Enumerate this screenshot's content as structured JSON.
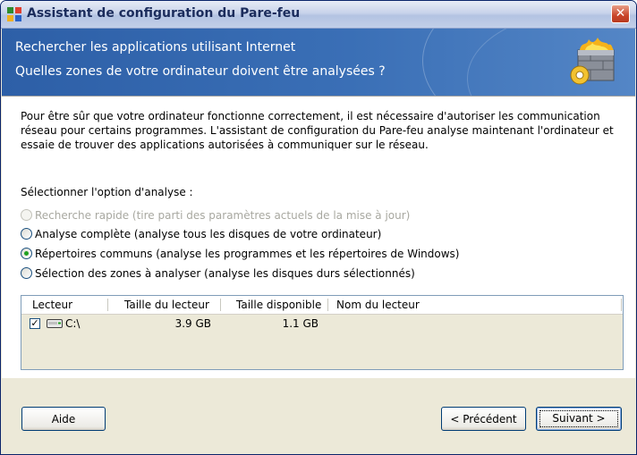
{
  "window": {
    "title": "Assistant de configuration du Pare-feu",
    "close_icon": "close-icon"
  },
  "header": {
    "title": "Rechercher les applications utilisant Internet",
    "subtitle": "Quelles zones de votre ordinateur doivent être analysées ?",
    "logo_icon": "firewall-icon"
  },
  "content": {
    "description": "Pour être sûr que votre ordinateur fonctionne correctement, il est nécessaire d'autoriser les communication réseau pour certains programmes. L'assistant de configuration du Pare-feu analyse maintenant l'ordinateur et essaie de trouver des applications autorisées à communiquer sur le réseau.",
    "scan_option_label": "Sélectionner l'option d'analyse :",
    "options": [
      {
        "label": "Recherche rapide (tire parti des paramètres actuels de la mise à jour)",
        "selected": false,
        "disabled": true
      },
      {
        "label": "Analyse complète (analyse tous les disques de votre ordinateur)",
        "selected": false,
        "disabled": false
      },
      {
        "label": "Répertoires communs (analyse les programmes et les répertoires de Windows)",
        "selected": true,
        "disabled": false
      },
      {
        "label": "Sélection des zones à analyser (analyse les disques durs sélectionnés)",
        "selected": false,
        "disabled": false
      }
    ]
  },
  "drive_table": {
    "columns": [
      "Lecteur",
      "Taille du lecteur",
      "Taille disponible",
      "Nom du lecteur"
    ],
    "rows": [
      {
        "checked": true,
        "drive": "C:\\",
        "size": "3.9 GB",
        "free": "1.1 GB",
        "name": ""
      }
    ]
  },
  "footer": {
    "help_label": "Aide",
    "back_label": "< Précédent",
    "next_label": "Suivant >"
  },
  "colors": {
    "header_bg": "#2d5fa7",
    "selected_radio": "#21a121",
    "title_text": "#1b2c5c"
  }
}
